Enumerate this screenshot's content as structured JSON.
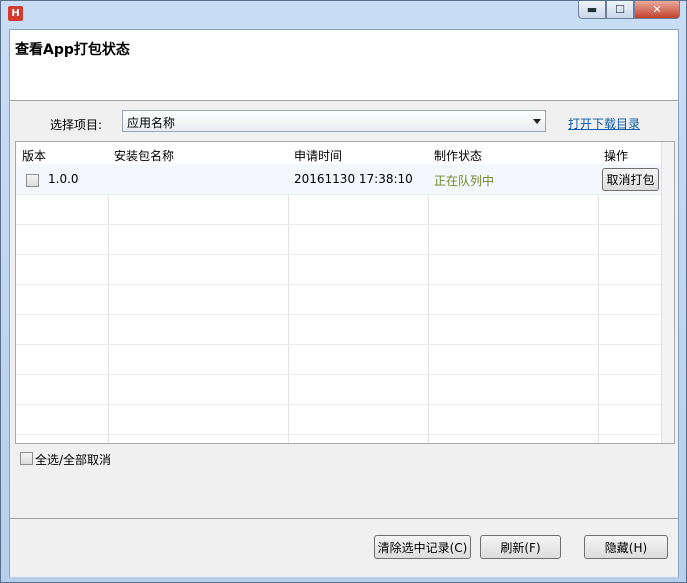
{
  "titlebar": {
    "app_icon_letter": "H",
    "minimize": "▬",
    "maximize": "☐",
    "close": "✕"
  },
  "header": {
    "title": "查看App打包状态"
  },
  "project_select": {
    "label": "选择项目:",
    "value": "应用名称"
  },
  "open_dir_link": "打开下载目录",
  "table": {
    "columns": [
      "版本",
      "安装包名称",
      "申请时间",
      "制作状态",
      "操作"
    ],
    "rows": [
      {
        "version": "1.0.0",
        "package_name": "",
        "time": "20161130 17:38:10",
        "status": "正在队列中",
        "action": "取消打包",
        "checked": false
      }
    ]
  },
  "select_all": {
    "label": "全选/全部取消",
    "checked": false
  },
  "footer": {
    "clear_button": "清除选中记录(C)",
    "refresh_button": "刷新(F)",
    "hide_button": "隐藏(H)"
  },
  "colors": {
    "status": "#6d8a2a",
    "link": "#0a5aa6",
    "close_button": "#c4412d"
  }
}
